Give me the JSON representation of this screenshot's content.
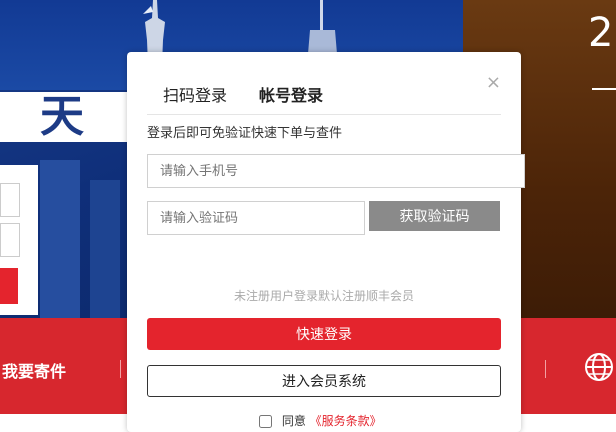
{
  "background": {
    "big_text": "2",
    "skyline_text": "天"
  },
  "nav": {
    "ship_label": "我要寄件"
  },
  "login": {
    "tabs": [
      "扫码登录",
      "帐号登录"
    ],
    "close_symbol": "×",
    "hint": "登录后即可免验证快速下单与查件",
    "phone_placeholder": "请输入手机号",
    "code_placeholder": "请输入验证码",
    "get_code_label": "获取验证码",
    "notice": "未注册用户登录默认注册顺丰会员",
    "login_button": "快速登录",
    "member_button": "进入会员系统",
    "agree_text": "同意",
    "terms_text": "《服务条款》"
  },
  "colors": {
    "accent": "#e4242d",
    "get_code_bg": "#8a8a8a"
  }
}
